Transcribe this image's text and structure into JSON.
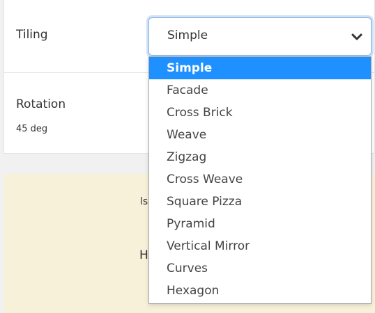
{
  "tiling": {
    "label": "Tiling",
    "selected_value": "Simple",
    "options": [
      "Simple",
      "Facade",
      "Cross Brick",
      "Weave",
      "Zigzag",
      "Cross Weave",
      "Square Pizza",
      "Pyramid",
      "Vertical Mirror",
      "Curves",
      "Hexagon"
    ],
    "selected_index": 0
  },
  "rotation": {
    "label": "Rotation",
    "value": "45 deg"
  },
  "background_fragments": {
    "frag1": "ls",
    "frag2": "H"
  },
  "colors": {
    "accent": "#1e90ff",
    "focus_ring": "#7fb0e4",
    "beige": "#f8f1da"
  },
  "icons": {
    "select_arrow": "chevron-down-icon"
  }
}
